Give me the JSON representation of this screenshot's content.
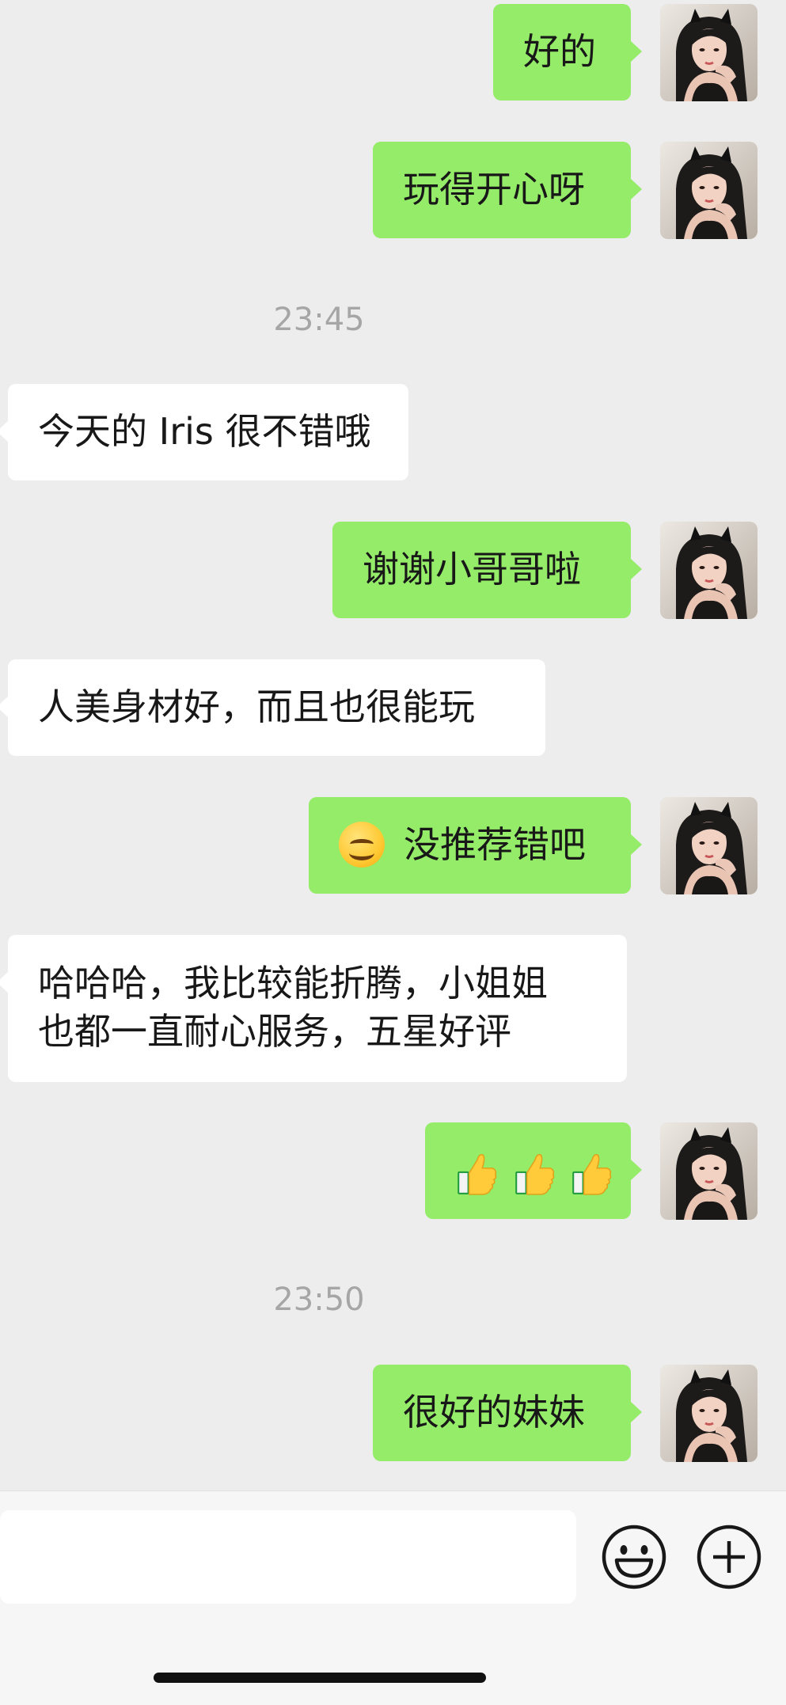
{
  "messages": [
    {
      "type": "out",
      "text": "好的"
    },
    {
      "type": "out",
      "text": "玩得开心呀"
    },
    {
      "type": "time",
      "text": "23:45"
    },
    {
      "type": "in",
      "text": "今天的 Iris 很不错哦"
    },
    {
      "type": "out",
      "text": "谢谢小哥哥啦"
    },
    {
      "type": "in",
      "text": "人美身材好，而且也很能玩"
    },
    {
      "type": "out",
      "emoji": "smile-emoji",
      "text": "没推荐错吧"
    },
    {
      "type": "in",
      "line1": "哈哈哈，我比较能折腾，小姐姐",
      "line2": "也都一直耐心服务，五星好评"
    },
    {
      "type": "out",
      "emoji": "thumbs-up-emoji-x3",
      "text": ""
    },
    {
      "type": "time",
      "text": "23:50"
    },
    {
      "type": "out",
      "text": "很好的妹妹"
    }
  ],
  "toolbar": {
    "input_value": "",
    "emoji_icon": "emoji-smile-icon",
    "plus_icon": "plus-circle-icon"
  },
  "colors": {
    "background": "#ededed",
    "outgoing_bubble": "#95ec69",
    "incoming_bubble": "#ffffff",
    "timestamp": "#a6a6a6"
  }
}
